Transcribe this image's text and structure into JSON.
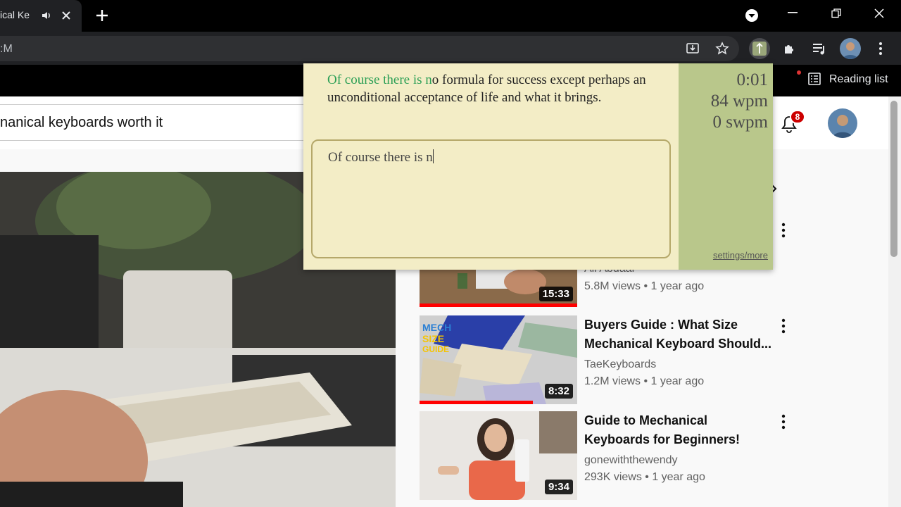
{
  "browser": {
    "tab_title": "ical Ke",
    "url_fragment": ":M",
    "reading_list_label": "Reading list"
  },
  "youtube": {
    "search_value": "nanical keyboards worth it",
    "notification_count": "8",
    "recommendations": [
      {
        "title": "",
        "channel": "Ali Abdaal",
        "meta": "5.8M views • 1 year ago",
        "duration": "15:33",
        "watched_fraction": 1.0
      },
      {
        "title": "Buyers Guide : What Size Mechanical Keyboard Should...",
        "channel": "TaeKeyboards",
        "meta": "1.2M views • 1 year ago",
        "duration": "8:32",
        "watched_fraction": 0.72,
        "thumb_text": "MECH SIZE GUIDE"
      },
      {
        "title": "Guide to Mechanical Keyboards for Beginners!",
        "channel": "gonewiththewendy",
        "meta": "293K views • 1 year ago",
        "duration": "9:34",
        "watched_fraction": 0
      }
    ]
  },
  "typing_popup": {
    "passage_typed": "Of course there is n",
    "passage_remaining": "o formula for success except perhaps an unconditional acceptance of life and what it brings.",
    "input_value": "Of course there is n",
    "timer": "0:01",
    "wpm": "84 wpm",
    "swpm": "0 swpm",
    "settings_link": "settings/more"
  },
  "colors": {
    "popup_bg": "#f3edc6",
    "popup_side": "#b9c78b",
    "typed_green": "#2b9f55",
    "yt_red": "#ff0000",
    "badge_red": "#cc0000"
  }
}
